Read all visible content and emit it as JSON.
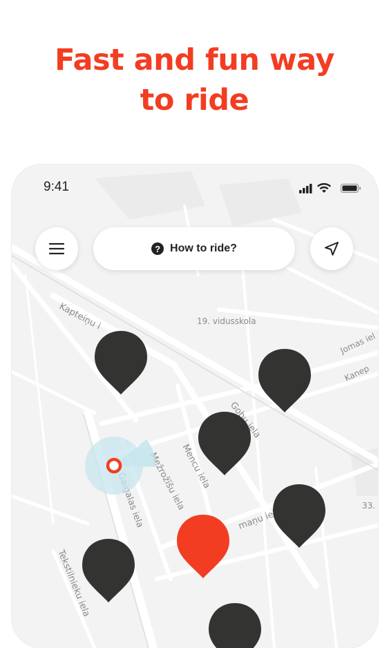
{
  "headline": {
    "line1": "Fast and fun way",
    "line2": "to ride"
  },
  "status_bar": {
    "time": "9:41"
  },
  "top_bar": {
    "how_to_ride_label": "How to ride?"
  },
  "map": {
    "street_labels": [
      "Kapteiņu i",
      "19. vidusskola",
      "Jomas iel",
      "Kanep",
      "Gobu iela",
      "Mencu iela",
      "Mežrožīšu iela",
      "Gaigalas iela",
      "maņu iel",
      "33.",
      "Tekstilnieku iela"
    ]
  },
  "colors": {
    "accent": "#f23d22",
    "pin": "#333432",
    "map_bg": "#f3f3f3",
    "road": "#ffffff"
  }
}
